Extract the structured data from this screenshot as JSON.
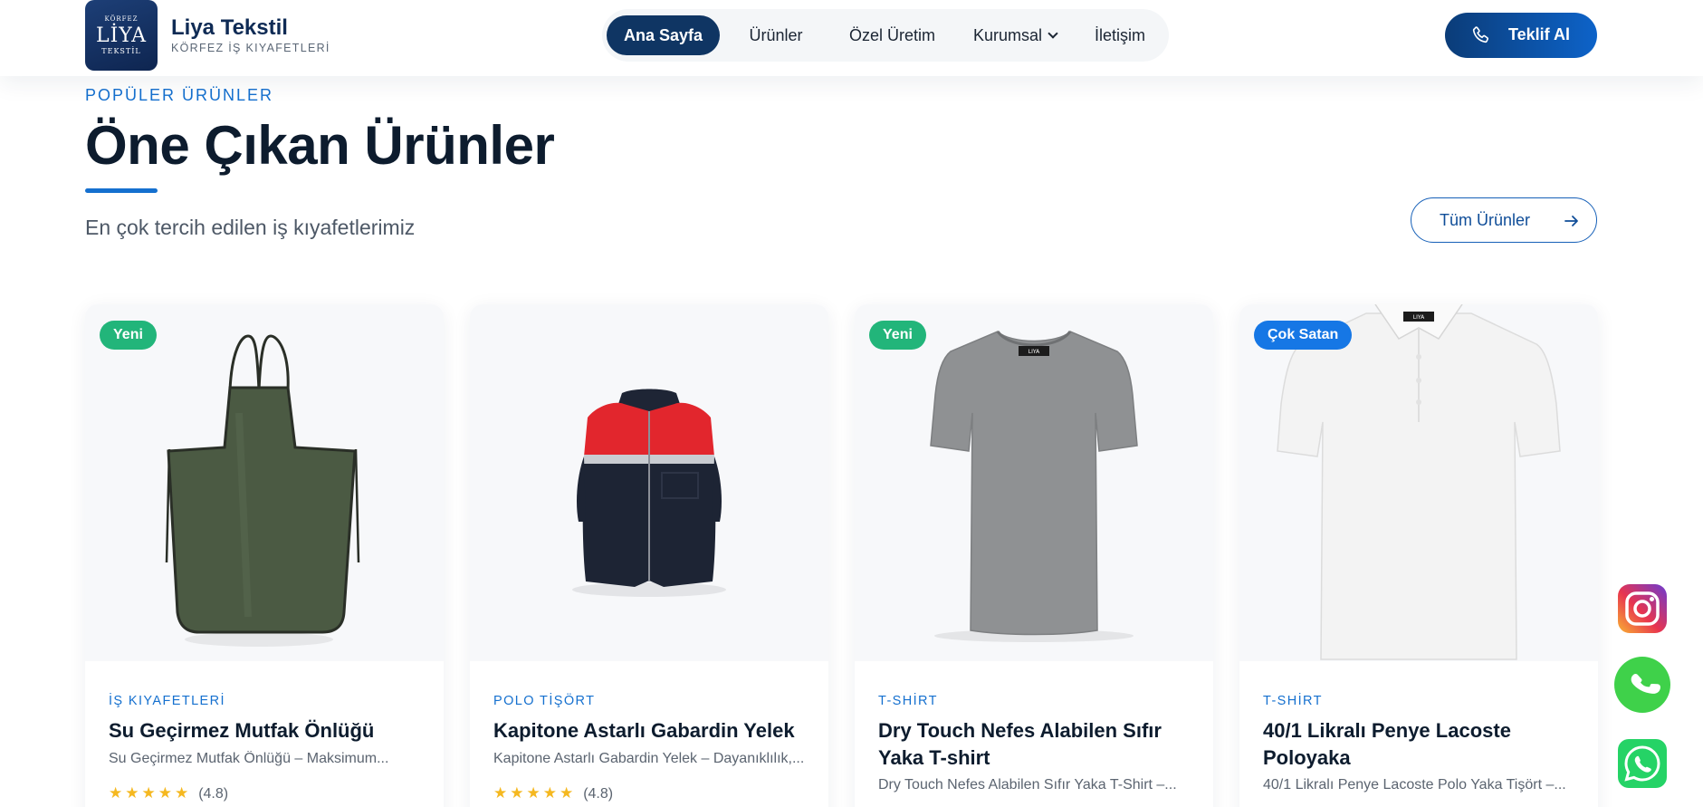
{
  "header": {
    "logo_line1": "KÖRFEZ",
    "logo_line2": "LİYA",
    "logo_line3": "TEKSTİL",
    "brand_name": "Liya Tekstil",
    "brand_sub": "KÖRFEZ İŞ KIYAFETLERİ",
    "nav": {
      "home": "Ana Sayfa",
      "products": "Ürünler",
      "custom": "Özel Üretim",
      "corporate": "Kurumsal",
      "contact": "İletişim"
    },
    "cta_label": "Teklif Al"
  },
  "section": {
    "eyebrow": "POPÜLER ÜRÜNLER",
    "title": "Öne Çıkan Ürünler",
    "subtitle": "En çok tercih edilen iş kıyafetlerimiz",
    "all_button": "Tüm Ürünler"
  },
  "products": [
    {
      "badge": "Yeni",
      "category": "İŞ KIYAFETLERİ",
      "title": "Su Geçirmez Mutfak Önlüğü",
      "description": "Su Geçirmez Mutfak Önlüğü – Maksimum...",
      "stars": "★★★★★",
      "rating": "(4.8)"
    },
    {
      "badge": "",
      "category": "POLO TİŞÖRT",
      "title": "Kapitone Astarlı Gabardin Yelek",
      "description": "Kapitone Astarlı Gabardin Yelek – Dayanıklılık,...",
      "stars": "★★★★★",
      "rating": "(4.8)"
    },
    {
      "badge": "Yeni",
      "category": "T-SHİRT",
      "title": "Dry Touch Nefes Alabilen Sıfır Yaka T-shirt",
      "description": "Dry Touch Nefes Alabilen Sıfır Yaka T-Shirt –...",
      "stars": "",
      "rating": ""
    },
    {
      "badge": "Çok Satan",
      "category": "T-SHİRT",
      "title": "40/1 Likralı Penye Lacoste Poloyaka",
      "description": "40/1 Likralı Penye Lacoste Polo Yaka Tişört –...",
      "stars": "",
      "rating": ""
    }
  ],
  "garment_labels": {
    "tshirt": "LIYA",
    "polo": "LIYA"
  },
  "colors": {
    "navy": "#0f3563",
    "accent": "#1570cf",
    "badge_new": "#22b57a",
    "badge_bestseller": "#1677e5",
    "whatsapp": "#25d366"
  },
  "floating": [
    "instagram-icon",
    "phone-icon",
    "whatsapp-icon"
  ]
}
